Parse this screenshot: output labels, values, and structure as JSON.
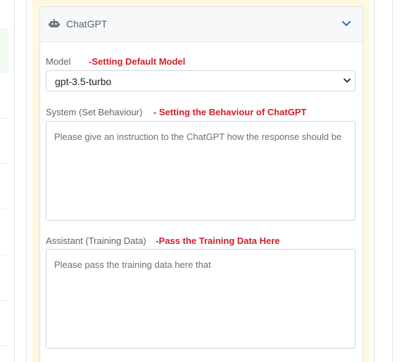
{
  "card": {
    "title": "ChatGPT",
    "icon": "robot-icon",
    "toggle_icon": "chevron-down-icon"
  },
  "model": {
    "label": "Model",
    "annotation": "-Setting Default Model",
    "selected": "gpt-3.5-turbo"
  },
  "system": {
    "label": "System (Set Behaviour)",
    "annotation": "- Setting the Behaviour of ChatGPT",
    "value": "Please give an instruction to the ChatGPT how the response should be"
  },
  "assistant": {
    "label": "Assistant (Training Data)",
    "annotation": "-Pass the Training Data Here",
    "value": "Please pass the training data here that"
  },
  "colors": {
    "annotation": "#d0202a",
    "panel_background": "#fdf8df",
    "accent_chevron": "#3b6fd6"
  }
}
